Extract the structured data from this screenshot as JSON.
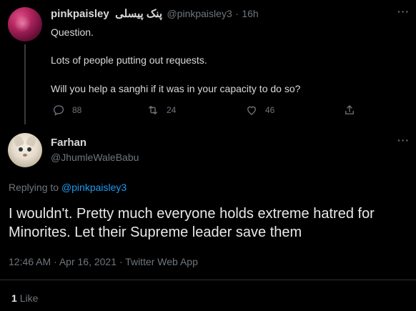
{
  "tweet1": {
    "display_name": "pinkpaisley",
    "display_name_alt": "پنک پیسلی",
    "handle": "@pinkpaisley3",
    "separator": "·",
    "time": "16h",
    "more": "···",
    "line1": "Question.",
    "line2": "Lots of people putting out requests.",
    "line3": "Will you help a sanghi if it was in your capacity to do so?",
    "replies": "88",
    "retweets": "24",
    "likes": "46"
  },
  "tweet2": {
    "display_name": "Farhan",
    "handle": "@JhumleWaleBabu",
    "more": "···",
    "replying_prefix": "Replying to",
    "replying_handle": "@pinkpaisley3",
    "text": "I wouldn't. Pretty much everyone holds extreme hatred for Minorites. Let their Supreme leader save them",
    "meta": "12:46 AM · Apr 16, 2021 · Twitter Web App",
    "likes_count": "1",
    "likes_label": "Like"
  },
  "colors": {
    "background": "#000000",
    "text": "#d9d9d9",
    "muted": "#6e767d",
    "link": "#1d9bf0",
    "divider": "#2f3336"
  },
  "icons": [
    "reply-icon",
    "retweet-icon",
    "like-icon",
    "share-icon",
    "more-icon"
  ]
}
